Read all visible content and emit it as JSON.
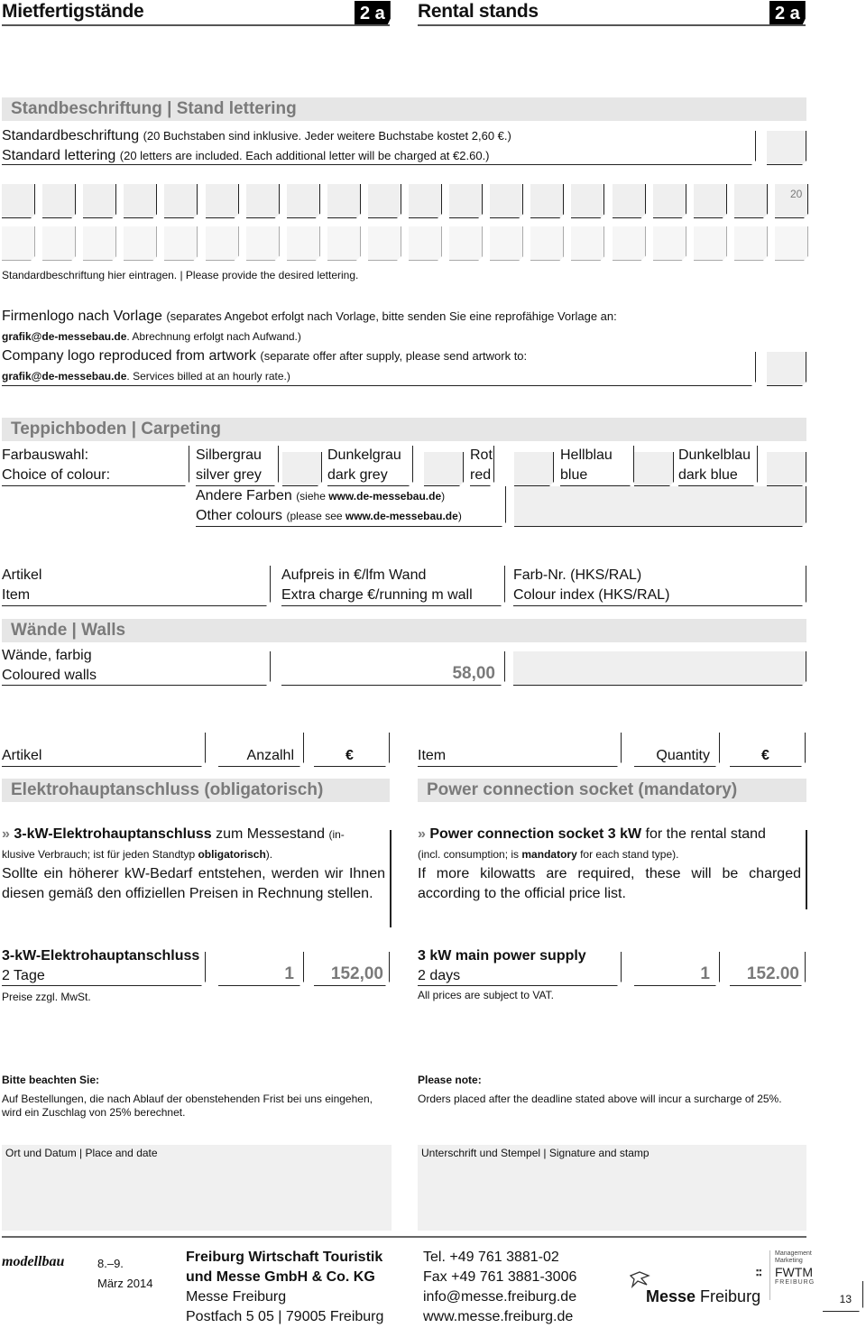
{
  "header": {
    "left_title": "Mietfertigstände",
    "right_title": "Rental stands",
    "badge": "2 a"
  },
  "stand_lettering": {
    "section_title": "Standbeschriftung | Stand lettering",
    "de_label": "Standardbeschriftung",
    "de_note": "(20 Buchstaben sind inklusive. Jeder weitere Buchstabe kostet 2,60 €.)",
    "en_label": "Standard lettering",
    "en_note": "(20 letters are included. Each additional letter will be charged at €2.60.)",
    "box_count_label": "20",
    "letter_boxes_per_row": 20,
    "hint": "Standardbeschriftung hier eintragen. | Please provide the desired lettering.",
    "logo_de_label": "Firmenlogo nach Vorlage",
    "logo_de_note": "(separates Angebot erfolgt nach Vorlage, bitte senden Sie eine reprofähige Vorlage an:",
    "logo_de_email": "grafik@de-messebau.de",
    "logo_de_note2": ". Abrechnung erfolgt nach Aufwand.)",
    "logo_en_label": "Company logo reproduced from artwork",
    "logo_en_note": "(separate offer after supply, please send artwork to:",
    "logo_en_email": "grafik@de-messebau.de",
    "logo_en_note2": ". Services billed at an hourly rate.)"
  },
  "carpeting": {
    "section_title": "Teppichboden | Carpeting",
    "choice_de": "Farbauswahl:",
    "choice_en": "Choice of colour:",
    "colors": [
      {
        "de": "Silbergrau",
        "en": "silver grey"
      },
      {
        "de": "Dunkelgrau",
        "en": "dark grey"
      },
      {
        "de": "Rot",
        "en": "red"
      },
      {
        "de": "Hellblau",
        "en": "blue"
      },
      {
        "de": "Dunkelblau",
        "en": "dark blue"
      }
    ],
    "other_de": "Andere Farben",
    "other_de_note": "(siehe ",
    "other_url": "www.de-messebau.de",
    "other_en": "Other colours",
    "other_en_note": "(please see "
  },
  "walls": {
    "col1_de": "Artikel",
    "col1_en": "Item",
    "col2_de": "Aufpreis in €/lfm Wand",
    "col2_en": "Extra charge €/running m wall",
    "col3_de": "Farb-Nr. (HKS/RAL)",
    "col3_en": "Colour index (HKS/RAL)",
    "section_title": "Wände | Walls",
    "row_de": "Wände, farbig",
    "row_en": "Coloured walls",
    "price": "58,00"
  },
  "power": {
    "de": {
      "col_item": "Artikel",
      "col_qty": "Anzalhl",
      "col_eur": "€",
      "section_title": "Elektrohauptanschluss (obligatorisch)",
      "bullet": "»",
      "lead_bold": "3-kW-Elektrohauptanschluss",
      "lead_rest": " zum Messestand ",
      "lead_small": "(in-",
      "line2a": "klusive Verbrauch; ist für jeden Standtyp ",
      "line2b": "obligatorisch",
      "line2c": ").",
      "para": "Sollte ein höherer kW-Bedarf entstehen, werden wir Ihnen diesen gemäß den offiziellen Preisen in Rechnung stellen.",
      "item_title": "3-kW-Elektrohauptanschluss",
      "item_sub": "2 Tage",
      "qty": "1",
      "price": "152,00",
      "vat_note": "Preise zzgl. MwSt."
    },
    "en": {
      "col_item": "Item",
      "col_qty": "Quantity",
      "col_eur": "€",
      "section_title": "Power connection socket (mandatory)",
      "bullet": "»",
      "lead_bold": "Power connection socket 3 kW",
      "lead_rest": " for the rental stand",
      "line2a": "(incl. consumption; is ",
      "line2b": "mandatory",
      "line2c": " for each stand type).",
      "para": "If more kilowatts are required, these will be charged according to the official  price list.",
      "item_title": "3 kW main power supply",
      "item_sub": "2 days",
      "qty": "1",
      "price": "152.00",
      "vat_note": "All prices are subject to VAT."
    }
  },
  "notes": {
    "de_title": "Bitte beachten Sie:",
    "de_text": "Auf Bestellungen, die nach Ablauf der obenstehenden Frist bei uns eingehen, wird ein Zuschlag von 25% berechnet.",
    "en_title": "Please note:",
    "en_text": "Orders placed after the deadline stated above will incur a surcharge of 25%."
  },
  "signature": {
    "place_date": "Ort und Datum | Place and date",
    "sign_stamp": "Unterschrift und Stempel | Signature and stamp"
  },
  "footer": {
    "event": "modellbau",
    "dates_line1": "8.–9.",
    "dates_line2": "März 2014",
    "org_line1": "Freiburg Wirtschaft Touristik",
    "org_line2": "und Messe GmbH & Co. KG",
    "org_line3": "Messe Freiburg",
    "org_line4": "Postfach 5 05 | 79005 Freiburg",
    "tel": "Tel. +49 761 3881-02",
    "fax": "Fax +49 761 3881-3006",
    "email": "info@messe.freiburg.de",
    "web": "www.messe.freiburg.de",
    "logo_bold": "Messe",
    "logo_rest": " Freiburg",
    "fwtm_small1": "Management",
    "fwtm_small2": "Marketing",
    "fwtm": "FWTM",
    "fwtm_city": "FREIBURG",
    "page_number": "13"
  }
}
